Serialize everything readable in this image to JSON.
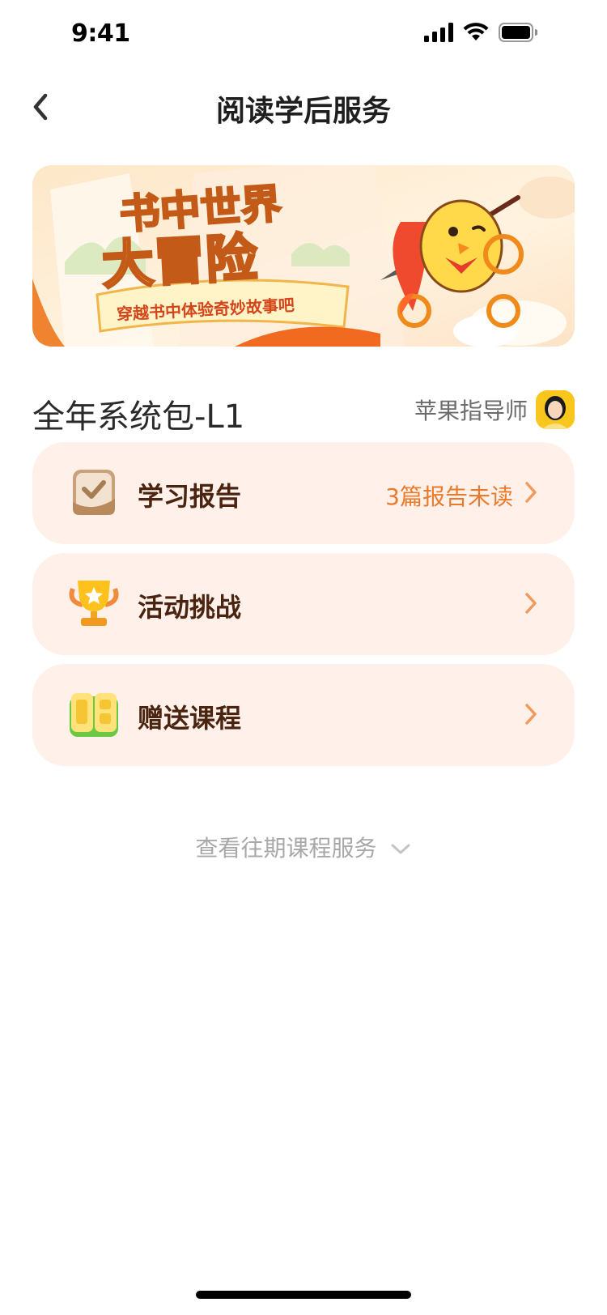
{
  "status_bar": {
    "time": "9:41"
  },
  "nav": {
    "title": "阅读学后服务"
  },
  "banner": {
    "title_line1": "书中世界",
    "title_line2": "大冒险",
    "subtitle": "穿越书中体验奇妙故事吧"
  },
  "package": {
    "title": "全年系统包-L1"
  },
  "mentor": {
    "label": "苹果指导师"
  },
  "cards": [
    {
      "label": "学习报告",
      "hint": "3篇报告未读",
      "icon": "report-icon"
    },
    {
      "label": "活动挑战",
      "hint": "",
      "icon": "trophy-icon"
    },
    {
      "label": "赠送课程",
      "hint": "",
      "icon": "book-icon"
    }
  ],
  "more_link": {
    "label": "查看往期课程服务"
  },
  "colors": {
    "card_bg": "#fff1ea",
    "accent": "#ea7a2c",
    "label": "#4a2410"
  }
}
